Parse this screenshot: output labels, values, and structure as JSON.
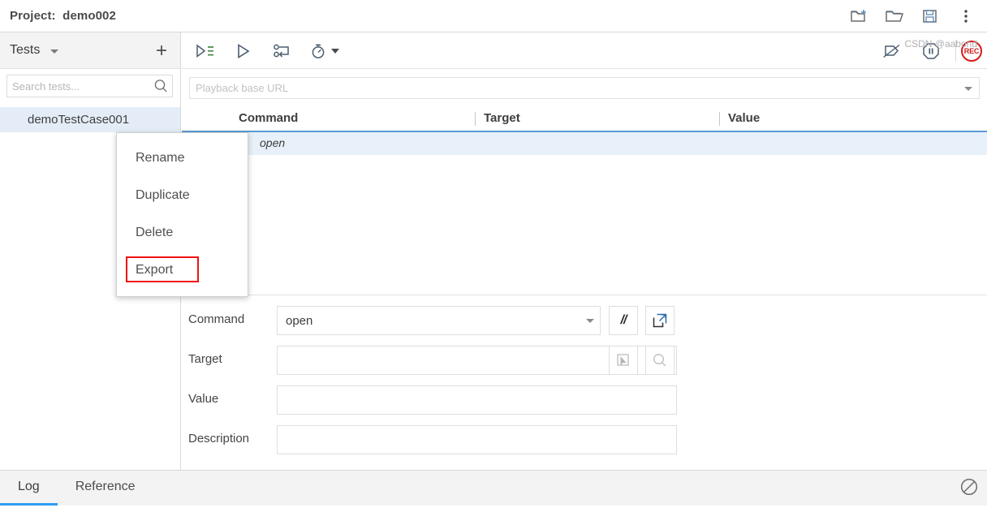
{
  "header": {
    "project_label": "Project:",
    "project_name": "demo002",
    "title": "Project:  demo002",
    "actions": [
      {
        "name": "new-project-icon",
        "label": "New project"
      },
      {
        "name": "open-project-icon",
        "label": "Open project"
      },
      {
        "name": "save-project-icon",
        "label": "Save project"
      },
      {
        "name": "more-options-icon",
        "label": "More options"
      }
    ]
  },
  "sidebar": {
    "title": "Tests",
    "add_label": "+",
    "search": {
      "placeholder": "Search tests...",
      "value": ""
    },
    "tests": [
      {
        "label": "demoTestCase001",
        "selected": true
      }
    ]
  },
  "context_menu": {
    "items": [
      {
        "label": "Rename"
      },
      {
        "label": "Duplicate"
      },
      {
        "label": "Delete"
      },
      {
        "label": "Export",
        "highlighted": true
      }
    ],
    "highlight_color": "#ee1111"
  },
  "toolbar": {
    "left": [
      {
        "name": "run-all-tests-icon",
        "label": "Run all tests"
      },
      {
        "name": "run-current-test-icon",
        "label": "Run current test"
      },
      {
        "name": "step-over-icon",
        "label": "Step over"
      },
      {
        "name": "playback-speed-icon",
        "label": "Playback speed"
      }
    ],
    "right": [
      {
        "name": "disable-breakpoints-icon",
        "label": "Disable breakpoints"
      },
      {
        "name": "pause-icon",
        "label": "Pause"
      },
      {
        "name": "record-button",
        "label": "REC"
      }
    ],
    "record_color": "#d51b1b"
  },
  "url_bar": {
    "placeholder": "Playback base URL",
    "value": ""
  },
  "command_table": {
    "columns": [
      "Command",
      "Target",
      "Value"
    ],
    "rows": [
      {
        "command": "open",
        "target": "",
        "value": "",
        "selected": true
      }
    ],
    "header_underline_color": "#5b9bd5",
    "selected_row_color": "#e8f1f9"
  },
  "detail_form": {
    "fields": [
      {
        "label": "Command",
        "value": "open",
        "placeholder": ""
      },
      {
        "label": "Target",
        "value": "",
        "placeholder": ""
      },
      {
        "label": "Value",
        "value": "",
        "placeholder": ""
      },
      {
        "label": "Description",
        "value": "",
        "placeholder": ""
      }
    ],
    "command_buttons": [
      {
        "name": "toggle-comment-button",
        "label": "//"
      },
      {
        "name": "open-command-docs-button",
        "label": "Open docs"
      }
    ],
    "target_buttons": [
      {
        "name": "select-target-button",
        "label": "Select target"
      },
      {
        "name": "find-target-button",
        "label": "Find target"
      }
    ]
  },
  "bottom_panel": {
    "tabs": [
      {
        "label": "Log",
        "active": true
      },
      {
        "label": "Reference",
        "active": false
      }
    ],
    "clear_icon": "clear-log-icon",
    "active_tab_color": "#2e9bf0",
    "log_entries": []
  },
  "watermark": "CSDN @aabond"
}
